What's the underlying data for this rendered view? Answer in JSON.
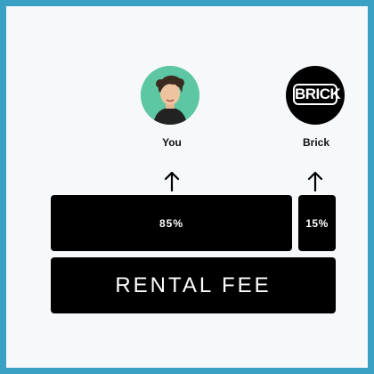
{
  "recipients": {
    "you": {
      "name": "You",
      "share": "85%"
    },
    "brick": {
      "name": "Brick",
      "share": "15%",
      "logo_text": "BRICK"
    }
  },
  "fee_label": "RENTAL FEE",
  "colors": {
    "frame": "#3aa0c4",
    "background": "#f7f8fa",
    "avatar_you_bg": "#5cc7a2",
    "block": "#000000"
  },
  "icons": {
    "up_arrow": "up-arrow-icon"
  }
}
